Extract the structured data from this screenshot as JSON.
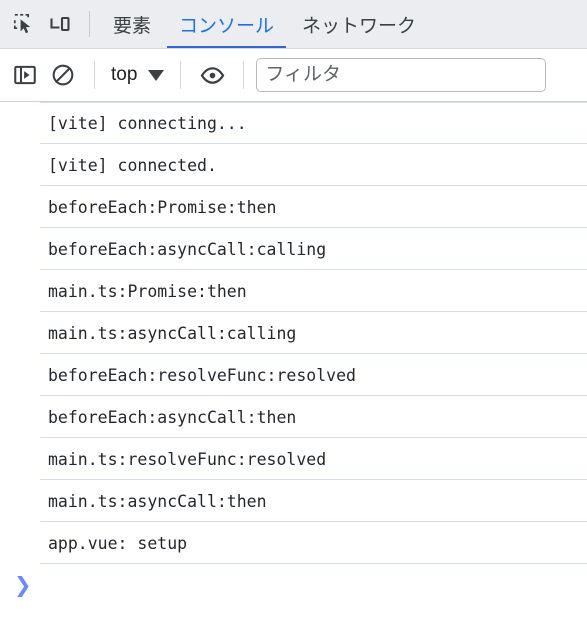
{
  "tabbar": {
    "inspect_icon": "inspect-element-icon",
    "device_icon": "device-toolbar-icon",
    "tabs": [
      {
        "label": "要素",
        "active": false
      },
      {
        "label": "コンソール",
        "active": true
      },
      {
        "label": "ネットワーク",
        "active": false
      }
    ],
    "active_tab_color": "#1a73e8",
    "active_underline_color": "#3367d6",
    "background": "#ebedf0"
  },
  "toolbar": {
    "sidebar_toggle_icon": "sidebar-panel-icon",
    "clear_console_icon": "clear-console-icon",
    "context_selector": {
      "value": "top",
      "caret_icon": "chevron-down-icon"
    },
    "live_expression_icon": "eye-icon",
    "filter": {
      "value": "",
      "placeholder": "フィルタ"
    }
  },
  "console": {
    "messages": [
      {
        "text": "[vite] connecting..."
      },
      {
        "text": "[vite] connected."
      },
      {
        "text": "beforeEach:Promise:then"
      },
      {
        "text": "beforeEach:asyncCall:calling"
      },
      {
        "text": "main.ts:Promise:then"
      },
      {
        "text": "main.ts:asyncCall:calling"
      },
      {
        "text": "beforeEach:resolveFunc:resolved"
      },
      {
        "text": "beforeEach:asyncCall:then"
      },
      {
        "text": "main.ts:resolveFunc:resolved"
      },
      {
        "text": "main.ts:asyncCall:then"
      },
      {
        "text": "app.vue: setup"
      }
    ],
    "divider_color": "#d3dcf0",
    "text_color": "#23272e"
  },
  "prompt": {
    "chevron": "❯",
    "chevron_color": "#6b8afd",
    "input_value": ""
  }
}
